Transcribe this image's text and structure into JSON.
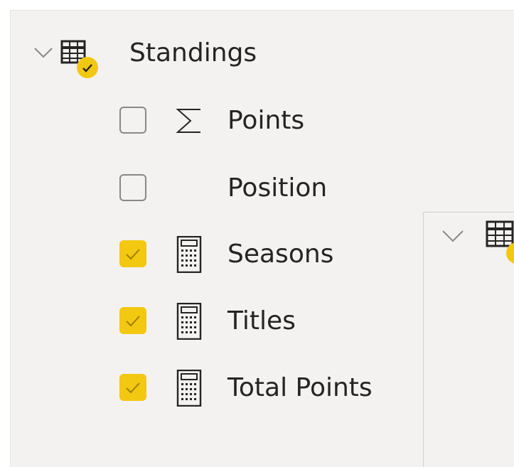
{
  "colors": {
    "accent": "#f2c811",
    "text": "#252423",
    "pane_bg": "#f3f2f1",
    "border": "#8a8886"
  },
  "table": {
    "name": "Standings",
    "expanded": true,
    "has_checked_fields": true,
    "icon": "table-icon"
  },
  "fields": [
    {
      "label": "Points",
      "checked": false,
      "icon": "sigma-icon"
    },
    {
      "label": "Position",
      "checked": false,
      "icon": "none"
    },
    {
      "label": "Seasons",
      "checked": true,
      "icon": "calculator-icon"
    },
    {
      "label": "Titles",
      "checked": true,
      "icon": "calculator-icon"
    },
    {
      "label": "Total Points",
      "checked": true,
      "icon": "calculator-icon"
    }
  ],
  "second_table": {
    "expanded": true,
    "icon": "table-icon",
    "has_checked_fields": true
  }
}
